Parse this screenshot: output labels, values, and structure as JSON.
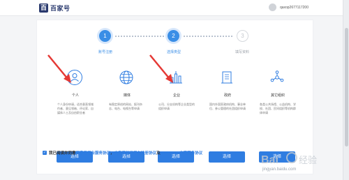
{
  "header": {
    "logo_mark": "百",
    "logo_text": "百家号",
    "username": "qaxop2677117200"
  },
  "stepper": {
    "steps": [
      {
        "number": "1",
        "label": "账号注册"
      },
      {
        "number": "2",
        "label": "选择类型"
      },
      {
        "number": "3",
        "label": "填写资料"
      }
    ]
  },
  "options": [
    {
      "title": "个人",
      "desc": "个人身份申请，适合垂直领域作者、意见领袖、评论家、自媒体人士及自由职业者",
      "button": "选择",
      "icon": "user-icon"
    },
    {
      "title": "媒体",
      "desc": "有稳定原创的网站、报刊杂志、电台、电视台等申请",
      "button": "选择",
      "icon": "globe-icon"
    },
    {
      "title": "企业",
      "desc": "公司、分支机构等企业类型的组织申请",
      "button": "选择",
      "icon": "building-chart-icon"
    },
    {
      "title": "政府",
      "desc": "国内外国家政府机构、事业单位、参公管理的社团组织申请",
      "button": "选择",
      "icon": "government-building-icon"
    },
    {
      "title": "其它组织",
      "desc": "各类公共场馆、公益机构、学校、社团、民间组织等机构群体申请",
      "button": "选择",
      "icon": "network-icon"
    }
  ],
  "agreement": {
    "checkmark": "✓",
    "prefix": "我已阅读并同意",
    "link1": "百家号平台服务协议",
    "sep1": "，",
    "link2": "内容原创发平台注册协议",
    "sep2": " 及 ",
    "link3": "ManPower方案服务协议"
  },
  "watermark": {
    "text": "jingyan.baidu.com"
  },
  "colors": {
    "primary": "#2f7de1",
    "step_active": "#3a8ee6",
    "arrow": "#e53935"
  }
}
